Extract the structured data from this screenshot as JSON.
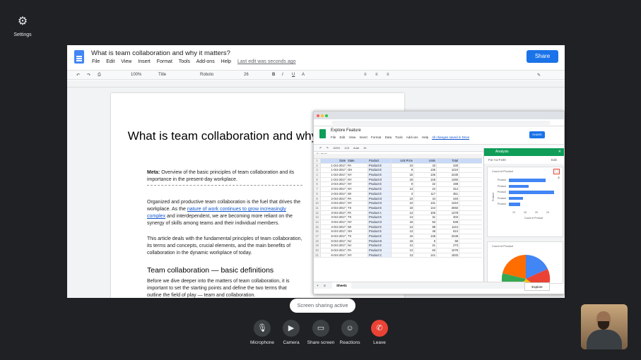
{
  "settings": {
    "label": "Settings"
  },
  "doc": {
    "title": "What is team collaboration and why it matters?",
    "menu": [
      "File",
      "Edit",
      "View",
      "Insert",
      "Format",
      "Tools",
      "Add-ons",
      "Help"
    ],
    "last_edit": "Last edit was seconds ago",
    "share_label": "Share",
    "toolbar": {
      "zoom": "100%",
      "style": "Title",
      "font": "Roboto",
      "size": "26"
    },
    "heading": "What is team collaboration and why it matters?",
    "meta_label": "Meta:",
    "meta_text": "Overview of the basic principles of team collaboration and its importance in the present-day workplace.",
    "p1_a": "Organized and productive team collaboration is the fuel that drives the workplace. As the",
    "p1_link": "nature of work continues to grow increasingly complex",
    "p1_b": "and interdependent, we are becoming more reliant on the synergy of skills among teams and their individual members.",
    "p2": "This article deals with the fundamental principles of team collaboration, its terms and concepts, crucial elements, and the main benefits of collaboration in the dynamic workplace of today.",
    "h2": "Team collaboration — basic definitions",
    "p3": "Before we dive deeper into the matters of team collaboration, it is important to set the starting points and define the two terms that outline the field of play — team and collaboration."
  },
  "sheet": {
    "title": "Explore Feature",
    "menu": [
      "File",
      "Edit",
      "View",
      "Insert",
      "Format",
      "Data",
      "Tools",
      "Add-ons",
      "Help"
    ],
    "saved": "All changes saved in Drive",
    "share_label": "SHARE",
    "toolbar": {
      "zoom": "100%",
      "font": "Arial",
      "size": "10",
      "fmt": "123"
    },
    "fx_label": "fx",
    "fx_value": "Date",
    "columns": [
      "",
      "A",
      "B",
      "C",
      "D",
      "E",
      "F"
    ],
    "headers": [
      "Date",
      "State",
      "Product",
      "Unit Price",
      "Units",
      "Total"
    ],
    "rows": [
      [
        "1-Oct-2017",
        "PA",
        "Product E",
        "10",
        "43",
        "430"
      ],
      [
        "1-Oct-2017",
        "OH",
        "Product E",
        "9",
        "136",
        "1224"
      ],
      [
        "1-Oct-2017",
        "NY",
        "Product E",
        "15",
        "136",
        "2430"
      ],
      [
        "1-Oct-2017",
        "NY",
        "Product D",
        "18",
        "145",
        "1450"
      ],
      [
        "2-Oct-2017",
        "NY",
        "Product E",
        "9",
        "22",
        "198"
      ],
      [
        "2-Oct-2017",
        "NY",
        "Product E",
        "13",
        "24",
        "312"
      ],
      [
        "2-Oct-2017",
        "WI",
        "Product E",
        "3",
        "117",
        "351"
      ],
      [
        "2-Oct-2017",
        "PA",
        "Product D",
        "10",
        "44",
        "440"
      ],
      [
        "2-Oct-2017",
        "NY",
        "Product D",
        "10",
        "131",
        "1310"
      ],
      [
        "2-Oct-2017",
        "TX",
        "Product E",
        "18",
        "144",
        "2592"
      ],
      [
        "3-Oct-2017",
        "PA",
        "Product A",
        "13",
        "106",
        "1378"
      ],
      [
        "3-Oct-2017",
        "TX",
        "Product E",
        "13",
        "31",
        "403"
      ],
      [
        "3-Oct-2017",
        "NY",
        "Product D",
        "18",
        "53",
        "538"
      ],
      [
        "4-Oct-2017",
        "WI",
        "Product E",
        "13",
        "88",
        "1144"
      ],
      [
        "5-Oct-2017",
        "OH",
        "Product E",
        "13",
        "48",
        "624"
      ],
      [
        "5-Oct-2017",
        "TX",
        "Product E",
        "16",
        "138",
        "2348"
      ],
      [
        "5-Oct-2017",
        "NJ",
        "Product B",
        "18",
        "5",
        "58"
      ],
      [
        "5-Oct-2017",
        "NJ",
        "Product E",
        "13",
        "21",
        "273"
      ],
      [
        "6-Oct-2017",
        "PA",
        "Product D",
        "13",
        "63",
        "1079"
      ],
      [
        "6-Oct-2017",
        "NY",
        "Product C",
        "13",
        "141",
        "1833"
      ]
    ],
    "tab": "Sheet1",
    "explore_tab": "Explore"
  },
  "explore": {
    "title": "Analysis",
    "range": "For A1:F100",
    "edit": "Edit",
    "bar_title": "Count of Product",
    "bar_categories": [
      "Product",
      "Product",
      "Product",
      "Product",
      "Product"
    ],
    "bar_xlabel": "Count of Product",
    "bar_ylabel": "Product",
    "bar_ticks": [
      "12",
      "16",
      "20",
      "24"
    ],
    "pie_title": "Count of Product",
    "colors": {
      "accent": "#0f9d58",
      "bar": "#4285f4",
      "pie": [
        "#4285f4",
        "#ea4335",
        "#fbbc04",
        "#34a853",
        "#ff6d01"
      ]
    }
  },
  "chart_data": {
    "type": "bar",
    "title": "Count of Product",
    "categories": [
      "Product",
      "Product",
      "Product",
      "Product",
      "Product"
    ],
    "values": [
      23,
      17,
      26,
      15,
      14
    ],
    "xlabel": "Count of Product",
    "ylabel": "Product",
    "xlim": [
      10,
      27
    ]
  },
  "meet": {
    "status": "Screen sharing active",
    "controls": [
      "Microphone",
      "Camera",
      "Share screen",
      "Reactions",
      "Leave"
    ]
  }
}
